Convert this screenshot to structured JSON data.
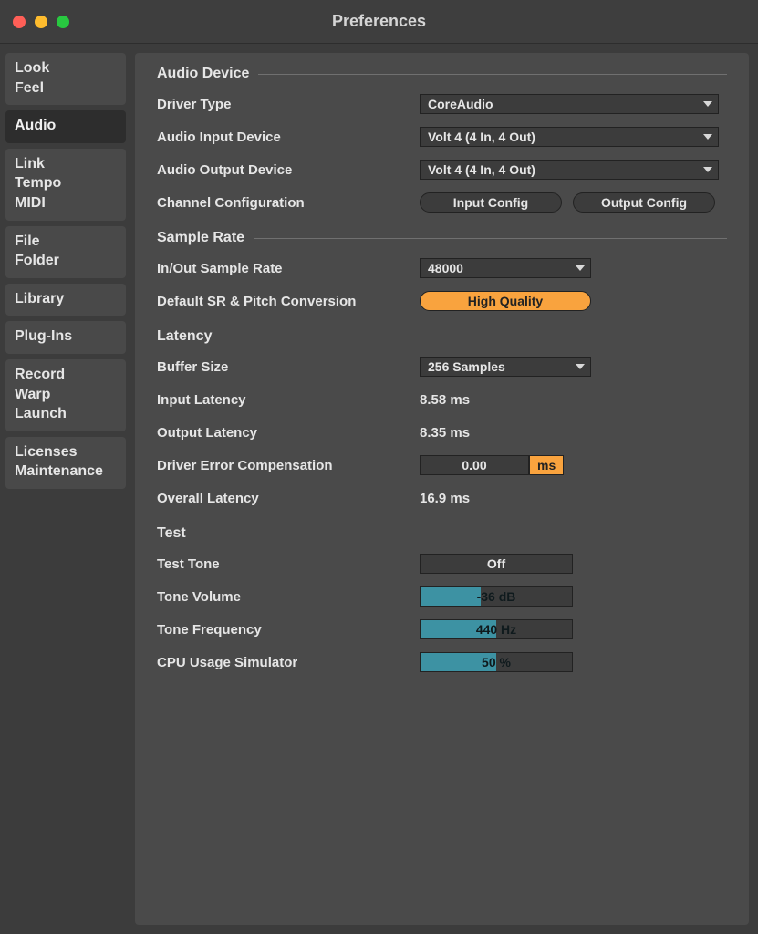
{
  "title": "Preferences",
  "sidebar": [
    {
      "lines": [
        "Look",
        "Feel"
      ],
      "active": false,
      "name": "sidebar-item-look-feel"
    },
    {
      "lines": [
        "Audio"
      ],
      "active": true,
      "name": "sidebar-item-audio"
    },
    {
      "lines": [
        "Link",
        "Tempo",
        "MIDI"
      ],
      "active": false,
      "name": "sidebar-item-link-tempo-midi"
    },
    {
      "lines": [
        "File",
        "Folder"
      ],
      "active": false,
      "name": "sidebar-item-file-folder"
    },
    {
      "lines": [
        "Library"
      ],
      "active": false,
      "name": "sidebar-item-library"
    },
    {
      "lines": [
        "Plug-Ins"
      ],
      "active": false,
      "name": "sidebar-item-plug-ins"
    },
    {
      "lines": [
        "Record",
        "Warp",
        "Launch"
      ],
      "active": false,
      "name": "sidebar-item-record-warp-launch"
    },
    {
      "lines": [
        "Licenses",
        "Maintenance"
      ],
      "active": false,
      "name": "sidebar-item-licenses-maintenance"
    }
  ],
  "sections": {
    "audio_device": {
      "title": "Audio Device",
      "driver_type_label": "Driver Type",
      "driver_type_value": "CoreAudio",
      "input_device_label": "Audio Input Device",
      "input_device_value": "Volt 4 (4 In, 4 Out)",
      "output_device_label": "Audio Output Device",
      "output_device_value": "Volt 4 (4 In, 4 Out)",
      "channel_config_label": "Channel Configuration",
      "input_config_btn": "Input Config",
      "output_config_btn": "Output Config"
    },
    "sample_rate": {
      "title": "Sample Rate",
      "inout_sr_label": "In/Out Sample Rate",
      "inout_sr_value": "48000",
      "default_sr_label": "Default SR & Pitch Conversion",
      "default_sr_value": "High Quality"
    },
    "latency": {
      "title": "Latency",
      "buffer_label": "Buffer Size",
      "buffer_value": "256 Samples",
      "input_latency_label": "Input Latency",
      "input_latency_value": "8.58 ms",
      "output_latency_label": "Output Latency",
      "output_latency_value": "8.35 ms",
      "driver_err_label": "Driver Error Compensation",
      "driver_err_value": "0.00",
      "driver_err_unit": "ms",
      "overall_label": "Overall Latency",
      "overall_value": "16.9 ms"
    },
    "test": {
      "title": "Test",
      "test_tone_label": "Test Tone",
      "test_tone_value": "Off",
      "tone_volume_label": "Tone Volume",
      "tone_volume_value": "-36 dB",
      "tone_volume_pct": 40,
      "tone_freq_label": "Tone Frequency",
      "tone_freq_value": "440 Hz",
      "tone_freq_pct": 50,
      "cpu_label": "CPU Usage Simulator",
      "cpu_value": "50 %",
      "cpu_pct": 50
    }
  }
}
